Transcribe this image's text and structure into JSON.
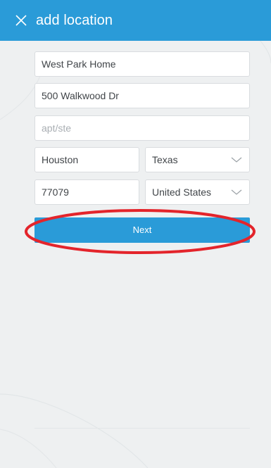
{
  "header": {
    "title": "add location",
    "close_icon": "close-icon",
    "background": "#2a9bd8"
  },
  "form": {
    "name": {
      "value": "West Park Home",
      "placeholder": ""
    },
    "street": {
      "value": "500 Walkwood Dr",
      "placeholder": ""
    },
    "apt": {
      "value": "",
      "placeholder": "apt/ste"
    },
    "city": {
      "value": "Houston"
    },
    "state": {
      "value": "Texas",
      "icon": "chevron-down-icon"
    },
    "zip": {
      "value": "77079"
    },
    "country": {
      "value": "United States",
      "icon": "chevron-down-icon"
    }
  },
  "actions": {
    "next_label": "Next",
    "accent": "#2a9bd8"
  },
  "annotation": {
    "highlight_color": "#e3242b"
  }
}
